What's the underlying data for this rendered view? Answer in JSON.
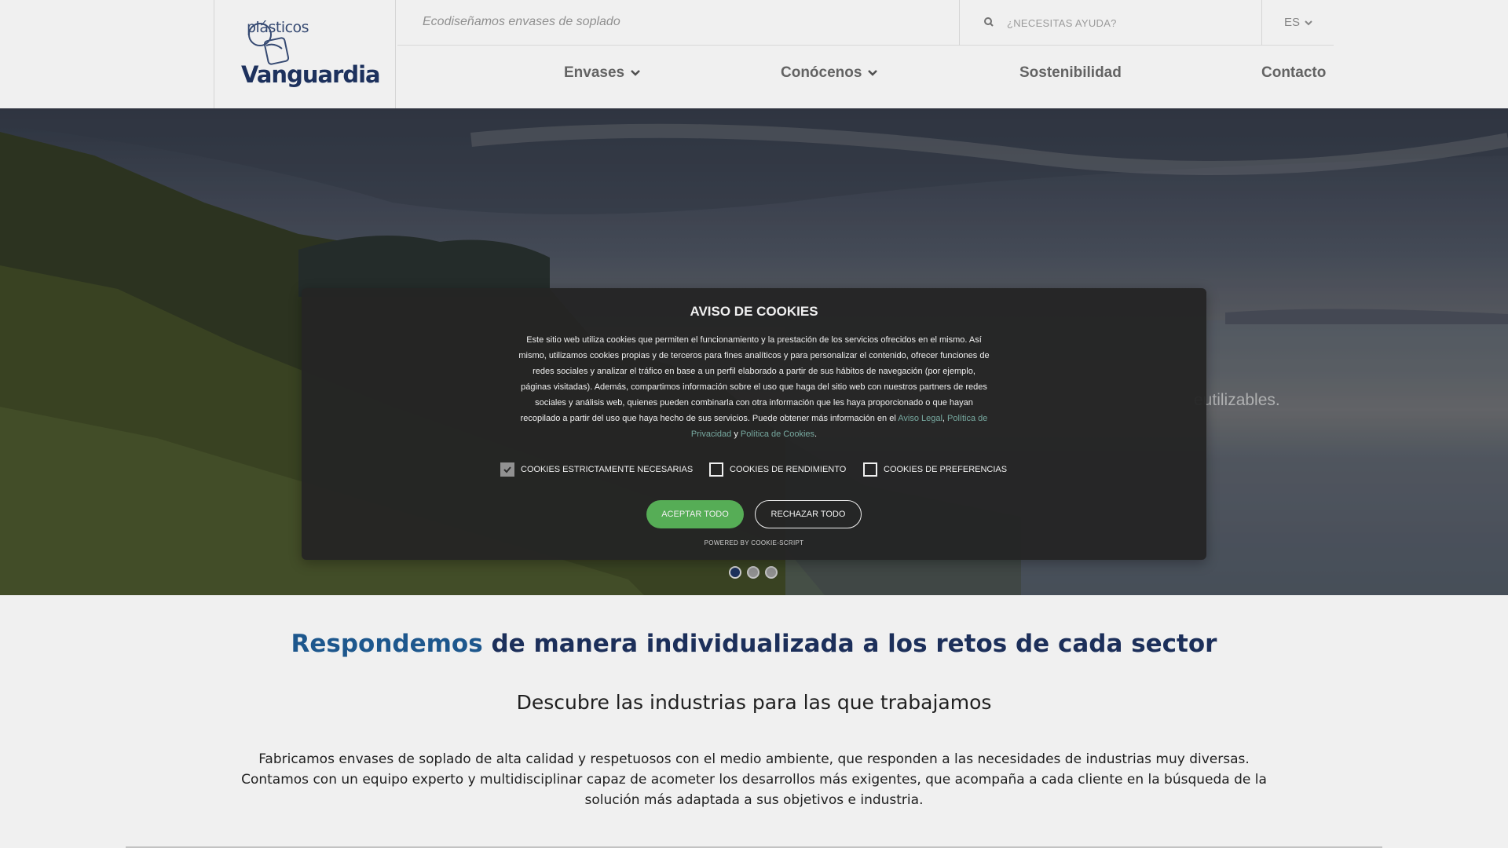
{
  "header": {
    "logo_small": "plásticos",
    "logo_big": "Vanguardia",
    "tagline": "Ecodiseñamos envases de soplado",
    "help_text": "¿NECESITAS AYUDA?",
    "language": "ES",
    "nav": [
      {
        "label": "Envases",
        "has_dropdown": true
      },
      {
        "label": "Conócenos",
        "has_dropdown": true
      },
      {
        "label": "Sostenibilidad",
        "has_dropdown": false
      },
      {
        "label": "Contacto",
        "has_dropdown": false
      }
    ]
  },
  "hero": {
    "partial_text": "eutilizables.",
    "slides_total": 3,
    "active_slide": 1
  },
  "cookie_modal": {
    "title": "AVISO DE COOKIES",
    "body_part1": "Este sitio web utiliza cookies que permiten el funcionamiento y la prestación de los servicios ofrecidos en el mismo. Así mismo, utilizamos cookies propias y de terceros para fines analíticos y para personalizar el contenido, ofrecer funciones de redes sociales y analizar el tráfico en base a un perfil elaborado a partir de sus hábitos de navegación (por ejemplo, páginas visitadas). Además, compartimos información sobre el uso que haga del sitio web con nuestros partners de redes sociales y análisis web, quienes pueden combinarla con otra información que les haya proporcionado o que hayan recopilado a partir del uso que haya hecho de sus servicios. Puede obtener más información en el",
    "link_legal": "Aviso Legal",
    "sep1": ",",
    "link_privacy": "Política de Privacidad",
    "sep2": "y",
    "link_cookies": "Política de Cookies",
    "end": ".",
    "checks": [
      {
        "label": "COOKIES ESTRICTAMENTE NECESARIAS",
        "checked": true
      },
      {
        "label": "COOKIES DE RENDIMIENTO",
        "checked": false
      },
      {
        "label": "COOKIES DE PREFERENCIAS",
        "checked": false
      }
    ],
    "accept_label": "ACEPTAR TODO",
    "reject_label": "RECHAZAR TODO",
    "powered": "POWERED BY COOKIE-SCRIPT"
  },
  "content": {
    "heading_accent": "Respondemos",
    "heading_rest": " de manera individualizada a los retos de cada sector",
    "subheading": "Descubre las industrias para las que trabajamos",
    "paragraph": "Fabricamos envases de soplado de alta calidad y respetuosos con el medio ambiente, que responden a las necesidades de industrias muy diversas. Contamos con un equipo experto y multidisciplinar capaz de acometer los desarrollos más exigentes, que acompaña a cada cliente en la búsqueda de la solución más adaptada a sus objetivos e industria."
  },
  "colors": {
    "accent_green": "#5cb85c",
    "brand_navy": "#1e3260",
    "brand_blue": "#1f5d96",
    "modal_bg": "#282828",
    "link_teal": "#7fb4aa"
  }
}
